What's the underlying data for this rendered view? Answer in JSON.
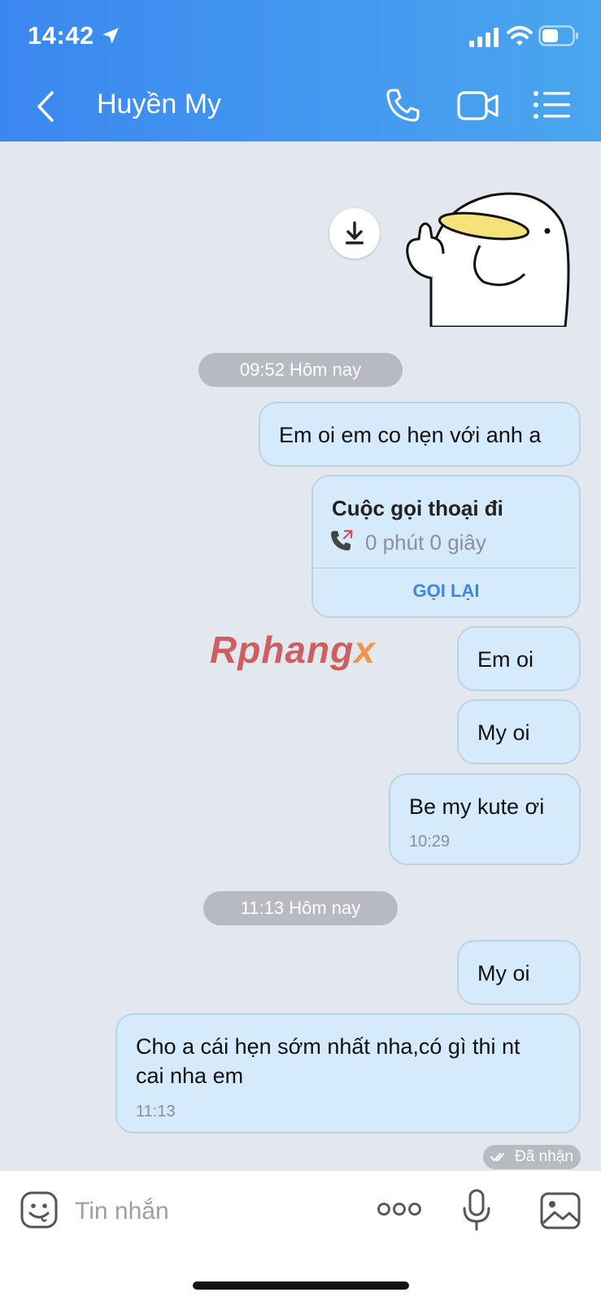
{
  "status_bar": {
    "time": "14:42"
  },
  "header": {
    "title": "Huyền My"
  },
  "colors": {
    "header_start": "#3b87f0",
    "header_end": "#4aa6ef",
    "bubble": "#d5eafb",
    "accent": "#3a87e2",
    "chat_bg": "#e3e8ef"
  },
  "icons": [
    "location-arrow-icon",
    "signal-icon",
    "wifi-icon",
    "battery-icon",
    "back-icon",
    "phone-icon",
    "video-icon",
    "menu-icon",
    "download-icon",
    "outgoing-call-icon",
    "double-check-icon",
    "sticker-emoji-icon",
    "more-icon",
    "mic-icon",
    "image-icon"
  ],
  "chat": {
    "divider_1": "09:52 Hôm nay",
    "msg_1": "Em oi em co hẹn với anh a",
    "call_card": {
      "title": "Cuộc gọi thoại đi",
      "duration": "0 phút 0 giây",
      "action": "GỌI LẠI"
    },
    "msg_2": "Em oi",
    "msg_3": "My oi",
    "msg_4": {
      "text": "Be my kute ơi",
      "time": "10:29"
    },
    "divider_2": "11:13 Hôm nay",
    "msg_5": "My oi",
    "msg_6": {
      "line1": "Cho a cái hẹn sớm nhất nha,có gì thi nt",
      "line2": "cai nha em",
      "time": "11:13"
    },
    "status": "Đã nhận"
  },
  "watermark": {
    "part1": "Rphang",
    "part2": "x"
  },
  "composer": {
    "placeholder": "Tin nhắn"
  }
}
